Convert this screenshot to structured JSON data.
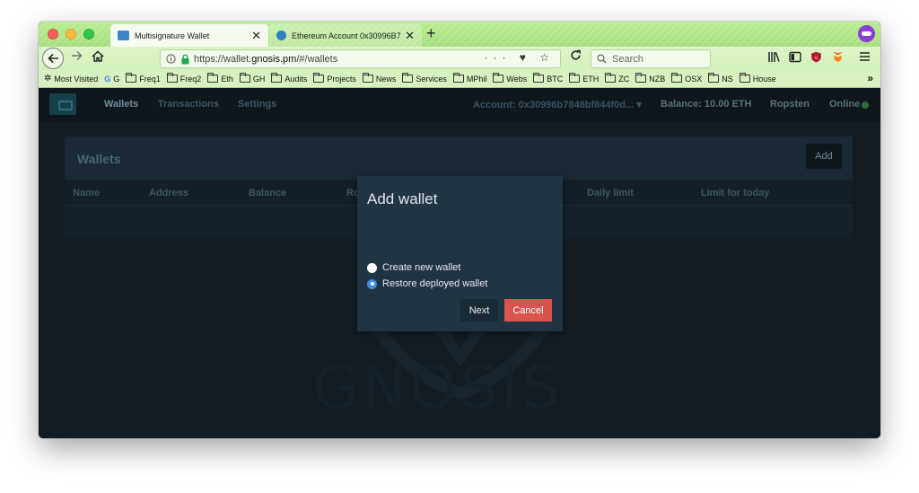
{
  "browser": {
    "tabs": [
      {
        "title": "Multisignature Wallet",
        "active": true,
        "icon": "wallet-favicon"
      },
      {
        "title": "Ethereum Account 0x30996B7",
        "active": false,
        "icon": "ethereum-favicon"
      }
    ],
    "tab_close": "✕",
    "new_tab": "+",
    "url": {
      "prefix": "https://wallet.",
      "domain": "gnosis.pm",
      "suffix": "/#/wallets"
    },
    "url_actions": "··· ♥ ☆",
    "search_placeholder": "Search",
    "colors": {
      "tabbar": "#b9ec90",
      "private": "#8d3cd6"
    },
    "bookmarks": [
      {
        "label": "Most Visited",
        "icon": "gear-icon"
      },
      {
        "label": "G",
        "icon": "google-icon"
      },
      {
        "label": "Freq1",
        "icon": "folder-icon"
      },
      {
        "label": "Freq2",
        "icon": "folder-icon"
      },
      {
        "label": "Eth",
        "icon": "folder-icon"
      },
      {
        "label": "GH",
        "icon": "folder-icon"
      },
      {
        "label": "Audits",
        "icon": "folder-icon"
      },
      {
        "label": "Projects",
        "icon": "folder-icon"
      },
      {
        "label": "News",
        "icon": "folder-icon"
      },
      {
        "label": "Services",
        "icon": "folder-icon"
      },
      {
        "label": "MPhil",
        "icon": "folder-icon"
      },
      {
        "label": "Webs",
        "icon": "folder-icon"
      },
      {
        "label": "BTC",
        "icon": "folder-icon"
      },
      {
        "label": "ETH",
        "icon": "folder-icon"
      },
      {
        "label": "ZC",
        "icon": "folder-icon"
      },
      {
        "label": "NZB",
        "icon": "folder-icon"
      },
      {
        "label": "OSX",
        "icon": "folder-icon"
      },
      {
        "label": "NS",
        "icon": "folder-icon"
      },
      {
        "label": "House",
        "icon": "folder-icon"
      }
    ],
    "bookmarks_overflow": "»"
  },
  "app": {
    "nav": {
      "wallets": "Wallets",
      "transactions": "Transactions",
      "settings": "Settings",
      "account": "Account: 0x30996b7848bf844f0d...",
      "account_caret": "▾",
      "balance": "Balance: 10.00 ETH",
      "network": "Ropsten",
      "status": "Online"
    },
    "panel": {
      "title": "Wallets",
      "add_label": "Add",
      "columns": [
        "Name",
        "Address",
        "Balance",
        "Ro",
        "Daily limit",
        "Limit for today"
      ]
    },
    "watermark": "GNOSIS"
  },
  "modal": {
    "title": "Add wallet",
    "options": [
      {
        "label": "Create new wallet",
        "selected": false
      },
      {
        "label": "Restore deployed wallet",
        "selected": true
      }
    ],
    "next_label": "Next",
    "cancel_label": "Cancel"
  }
}
